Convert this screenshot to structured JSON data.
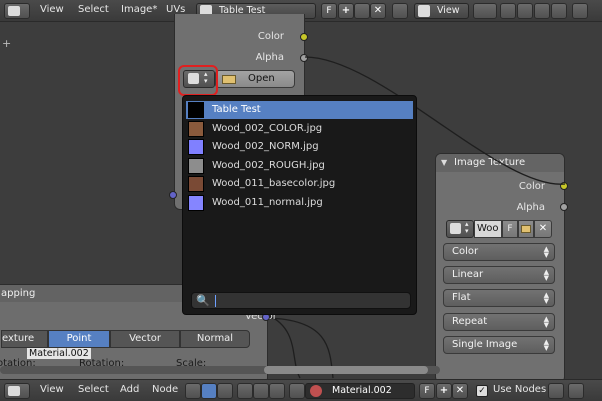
{
  "top_bar": {
    "menu": [
      "View",
      "Select",
      "Image*",
      "UVs"
    ],
    "image_name": "Table Test",
    "fake_user": "F",
    "view_label": "View"
  },
  "node_left": {
    "sockets": [
      "Color",
      "Alpha"
    ],
    "open_label": "Open"
  },
  "popup": {
    "items": [
      {
        "label": "Table Test",
        "color": "#000000",
        "active": true
      },
      {
        "label": "Wood_002_COLOR.jpg",
        "color": "#8a5a3c",
        "active": false
      },
      {
        "label": "Wood_002_NORM.jpg",
        "color": "#8080ff",
        "active": false
      },
      {
        "label": "Wood_002_ROUGH.jpg",
        "color": "#8d8d8d",
        "active": false
      },
      {
        "label": "Wood_011_basecolor.jpg",
        "color": "#7a4a35",
        "active": false
      },
      {
        "label": "Wood_011_normal.jpg",
        "color": "#8585ff",
        "active": false
      }
    ],
    "search_value": ""
  },
  "node_right": {
    "title": "Image Texture",
    "outputs": [
      "Color",
      "Alpha"
    ],
    "image_name": "Woo",
    "fake_user": "F",
    "selects": [
      "Color",
      "Linear",
      "Flat",
      "Repeat",
      "Single Image"
    ]
  },
  "mapping": {
    "title": "apping",
    "tabs": [
      "exture",
      "Point",
      "Vector",
      "Normal"
    ],
    "active_tab": "Point",
    "material_label": "Material.002",
    "row_labels": [
      "otation:",
      "Rotation:",
      "Scale:"
    ],
    "vector_label": "Vector"
  },
  "bottom_bar": {
    "menu": [
      "View",
      "Select",
      "Add",
      "Node"
    ],
    "material_name": "Material.002",
    "fake_user": "F",
    "use_nodes_label": "Use Nodes",
    "use_nodes_checked": true
  },
  "colors": {
    "accent": "#5680c2",
    "highlight_ring": "#e02020",
    "socket_yellow": "#c7c729",
    "socket_grey": "#a1a1a1",
    "socket_purple": "#6363c7"
  }
}
